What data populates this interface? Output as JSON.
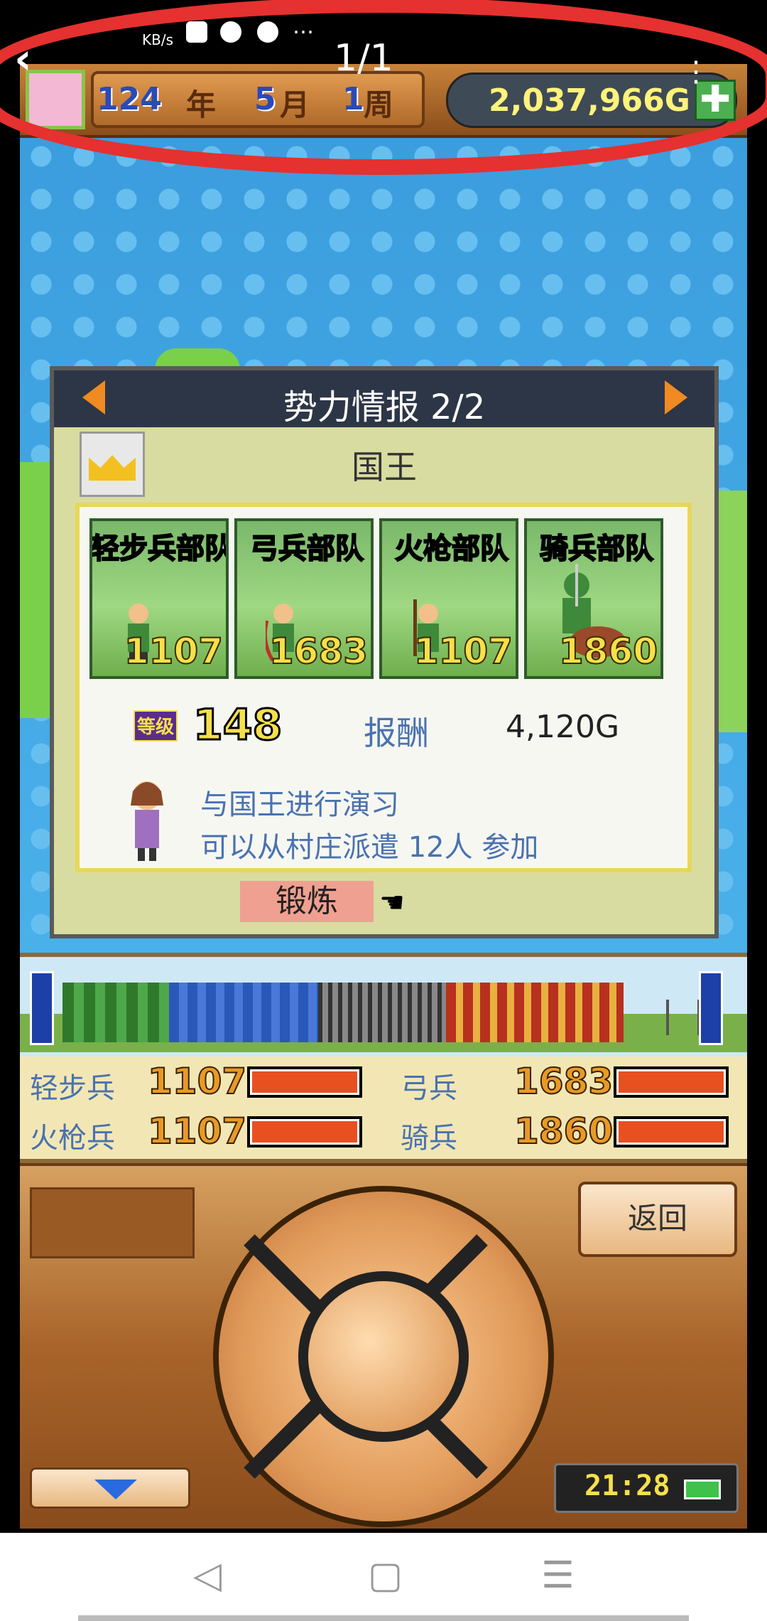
{
  "status_bar": {
    "speed_unit": "KB/s",
    "dots": "…"
  },
  "viewer": {
    "back_icon": "‹",
    "count": "1/1",
    "more_icon": "⋮"
  },
  "header": {
    "year_num": "124",
    "year_unit": "年",
    "month_num": "5",
    "month_unit": "月",
    "week_num": "1",
    "week_unit": "周",
    "gold": "2,037,966G",
    "plus_label": "✚"
  },
  "dialog": {
    "title": "势力情报 2/2",
    "king_label": "国王",
    "units": [
      {
        "label": "轻步兵部队",
        "value": "1107"
      },
      {
        "label": "弓兵部队",
        "value": "1683"
      },
      {
        "label": "火枪部队",
        "value": "1107"
      },
      {
        "label": "骑兵部队",
        "value": "1860"
      }
    ],
    "level_badge": "等级",
    "level": "148",
    "reward_label": "报酬",
    "reward": "4,120G",
    "desc_line1": "与国王进行演习",
    "desc_line2": "可以从村庄派遣 12人 参加",
    "train_button": "锻炼",
    "hand_icon": "☚"
  },
  "stats": [
    {
      "label": "轻步兵",
      "value": "1107",
      "fill": 1.0
    },
    {
      "label": "弓兵",
      "value": "1683",
      "fill": 1.0
    },
    {
      "label": "火枪兵",
      "value": "1107",
      "fill": 1.0
    },
    {
      "label": "骑兵",
      "value": "1860",
      "fill": 1.0
    }
  ],
  "controller": {
    "back_button": "返回",
    "clock": "21:28"
  },
  "navbar": {
    "back": "◁",
    "home": "▢",
    "menu": "☰"
  },
  "colors": {
    "annotation": "#e5312f",
    "gold_text": "#fff37a",
    "bar": "#e85020"
  }
}
